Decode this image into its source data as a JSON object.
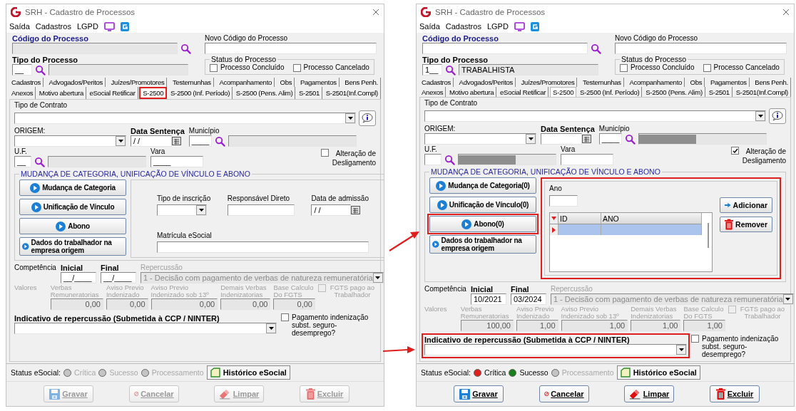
{
  "windows": [
    {
      "title": "SRH - Cadastro de Processos",
      "menu": [
        "Saída",
        "Cadastros",
        "LGPD"
      ],
      "codigo": {
        "label": "Código do Processo",
        "disabled": true
      },
      "novo_codigo": {
        "label": "Novo Código do Processo"
      },
      "tipo": {
        "label": "Tipo do Processo",
        "code": "__"
      },
      "status_processo": {
        "label": "Status do Processo",
        "options": [
          {
            "label": "Processo Concluído",
            "checked": false
          },
          {
            "label": "Processo Cancelado",
            "checked": false
          }
        ]
      },
      "tab_rows": [
        {
          "tabs": [
            {
              "label": "Cadastros",
              "selected": false,
              "highlighted": false
            },
            {
              "label": "Advogados/Peritos",
              "selected": false,
              "highlighted": false
            },
            {
              "label": "Juízes/Promotores",
              "selected": false,
              "highlighted": false
            },
            {
              "label": "Testemunhas",
              "selected": false,
              "highlighted": false
            },
            {
              "label": "Acompanhamento",
              "selected": false,
              "highlighted": false
            },
            {
              "label": "Obs",
              "selected": false,
              "highlighted": false
            },
            {
              "label": "Pagamentos",
              "selected": false,
              "highlighted": false
            },
            {
              "label": "Bens Penh.",
              "selected": false,
              "highlighted": false
            }
          ]
        },
        {
          "tabs": [
            {
              "label": "Anexos",
              "selected": false,
              "highlighted": false
            },
            {
              "label": "Motivo abertura",
              "selected": false,
              "highlighted": false
            },
            {
              "label": "eSocial Retificar",
              "selected": false,
              "highlighted": false
            },
            {
              "label": "S-2500",
              "selected": true,
              "highlighted": true
            },
            {
              "label": "S-2500 (Inf. Período)",
              "selected": false,
              "highlighted": false
            },
            {
              "label": "S-2500 (Pens. Alim)",
              "selected": false,
              "highlighted": false
            },
            {
              "label": "S-2501",
              "selected": false,
              "highlighted": false
            },
            {
              "label": "S-2501(Inf.Compl)",
              "selected": false,
              "highlighted": false
            }
          ]
        }
      ],
      "contrato": {
        "label": "Tipo de Contrato"
      },
      "origem": {
        "label": "ORIGEM:"
      },
      "data_sentenca": {
        "label": "Data Sentença",
        "value": "/ /"
      },
      "municipio": {
        "label": "Município",
        "code": "____",
        "redacted": false
      },
      "uf": {
        "label": "U.F.",
        "code": "__",
        "redacted": false
      },
      "vara": {
        "label": "Vara",
        "value": "____"
      },
      "alteracao": {
        "label": "Alteração de Desligamento",
        "checked": false
      },
      "group": {
        "title": "MUDANÇA DE CATEGORIA, UNIFICAÇÃO DE VÍNCULO E ABONO",
        "buttons": [
          {
            "label": "Mudança de Categoria",
            "highlighted": false
          },
          {
            "label": "Unificação de Vínculo",
            "highlighted": false
          },
          {
            "label": "Abono",
            "highlighted": false
          },
          {
            "label": "Dados do trabalhador na empresa origem",
            "highlighted": false
          }
        ],
        "panel": {
          "kind": "vinculo",
          "highlighted": false,
          "tipo_inscricao": "Tipo de inscrição",
          "responsavel": "Responsável Direto",
          "data_admissao": {
            "label": "Data de admissão",
            "value": "/ /"
          },
          "matricula": "Matrícula eSocial"
        }
      },
      "competencia": {
        "label": "Competência",
        "inicial": {
          "label": "Inicial",
          "value": "__/____"
        },
        "final": {
          "label": "Final",
          "value": "__/____"
        },
        "repercussao": {
          "label": "Repercussão",
          "value": "1 - Decisão com pagamento de verbas de natureza remuneratória"
        }
      },
      "valores": {
        "label": "Valores",
        "items": [
          {
            "label": "Verbas Remuneratorias",
            "value": "0,00"
          },
          {
            "label": "Aviso Previo Indenizado",
            "value": "0,00"
          },
          {
            "label": "Aviso Previo Indenizado sob 13º",
            "value": "0,00"
          },
          {
            "label": "Demais Verbas Indenizatorias",
            "value": "0,00"
          },
          {
            "label": "Base Calculo Do FGTS",
            "value": "0,00"
          }
        ],
        "fgts": {
          "label": "FGTS pago ao Trabalhador",
          "checked": false
        }
      },
      "indicativo": {
        "label": "Indicativo de repercussão (Submetida à CCP / NINTER)",
        "highlighted": false
      },
      "pagamento": {
        "label": "Pagamento indenização subst. seguro-desemprego?",
        "checked": false
      },
      "status_esocial": {
        "label": "Status eSocial:",
        "items": [
          {
            "label": "Crítica",
            "color": "#c4c4c4",
            "active": false
          },
          {
            "label": "Sucesso",
            "color": "#c4c4c4",
            "active": false
          },
          {
            "label": "Processamento",
            "color": "#c4c4c4",
            "active": false
          }
        ],
        "historico": "Histórico eSocial"
      },
      "actions": [
        {
          "label": "Gravar",
          "kind": "save",
          "disabled": true
        },
        {
          "label": "Cancelar",
          "kind": "cancel",
          "disabled": true
        },
        {
          "label": "Limpar",
          "kind": "clear",
          "disabled": true
        },
        {
          "label": "Excluir",
          "kind": "delete",
          "disabled": true
        }
      ]
    },
    {
      "title": "SRH - Cadastro de Processos",
      "menu": [
        "Saída",
        "Cadastros",
        "LGPD"
      ],
      "codigo": {
        "label": "Código do Processo",
        "disabled": false
      },
      "novo_codigo": {
        "label": "Novo Código do Processo"
      },
      "tipo": {
        "label": "Tipo do Processo",
        "code": "1__",
        "description": "TRABALHISTA"
      },
      "status_processo": {
        "label": "Status do Processo",
        "options": [
          {
            "label": "Processo Concluído",
            "checked": false
          },
          {
            "label": "Processo Cancelado",
            "checked": false
          }
        ]
      },
      "tab_rows": [
        {
          "tabs": [
            {
              "label": "Cadastros",
              "selected": false,
              "highlighted": false
            },
            {
              "label": "Advogados/Peritos",
              "selected": false,
              "highlighted": false
            },
            {
              "label": "Juízes/Promotores",
              "selected": false,
              "highlighted": false
            },
            {
              "label": "Testemunhas",
              "selected": false,
              "highlighted": false
            },
            {
              "label": "Acompanhamento",
              "selected": false,
              "highlighted": false
            },
            {
              "label": "Obs",
              "selected": false,
              "highlighted": false
            },
            {
              "label": "Pagamentos",
              "selected": false,
              "highlighted": false
            },
            {
              "label": "Bens Penh.",
              "selected": false,
              "highlighted": false
            }
          ]
        },
        {
          "tabs": [
            {
              "label": "Anexos",
              "selected": false,
              "highlighted": false
            },
            {
              "label": "Motivo abertura",
              "selected": false,
              "highlighted": false
            },
            {
              "label": "eSocial Retificar",
              "selected": false,
              "highlighted": false
            },
            {
              "label": "S-2500",
              "selected": true,
              "highlighted": false
            },
            {
              "label": "S-2500 (Inf. Período)",
              "selected": false,
              "highlighted": false
            },
            {
              "label": "S-2500 (Pens. Alim)",
              "selected": false,
              "highlighted": false
            },
            {
              "label": "S-2501",
              "selected": false,
              "highlighted": false
            },
            {
              "label": "S-2501(Inf.Compl)",
              "selected": false,
              "highlighted": false
            }
          ]
        }
      ],
      "contrato": {
        "label": "Tipo de Contrato"
      },
      "origem": {
        "label": "ORIGEM:"
      },
      "data_sentenca": {
        "label": "Data Sentença"
      },
      "municipio": {
        "label": "Município",
        "code": "____",
        "redacted": true
      },
      "uf": {
        "label": "U.F.",
        "redacted": true
      },
      "vara": {
        "label": "Vara"
      },
      "alteracao": {
        "label": "Alteração de Desligamento",
        "checked": true
      },
      "group": {
        "title": "MUDANÇA DE CATEGORIA, UNIFICAÇÃO DE VÍNCULO E ABONO",
        "buttons": [
          {
            "label": "Mudança de Categoria(0)",
            "highlighted": false
          },
          {
            "label": "Unificação de Vínculo(0)",
            "highlighted": false
          },
          {
            "label": "Abono(0)",
            "highlighted": true
          },
          {
            "label": "Dados do trabalhador na empresa origem",
            "highlighted": false
          }
        ],
        "panel": {
          "kind": "abono",
          "highlighted": true,
          "ano": "Ano",
          "columns": [
            "ID",
            "ANO"
          ],
          "rows": [
            {
              "selected": true
            }
          ],
          "add": "Adicionar",
          "remove": "Remover"
        }
      },
      "competencia": {
        "label": "Competência",
        "inicial": {
          "label": "Inicial",
          "value": "10/2021"
        },
        "final": {
          "label": "Final",
          "value": "03/2024"
        },
        "repercussao": {
          "label": "Repercussão",
          "value": "1 - Decisão com pagamento de verbas de natureza remuneratória"
        }
      },
      "valores": {
        "label": "Valores",
        "items": [
          {
            "label": "Verbas Remuneratorias",
            "value": "100,00"
          },
          {
            "label": "Aviso Previo Indenizado",
            "value": "1,00"
          },
          {
            "label": "Aviso Previo Indenizado sob 13º",
            "value": "1,00"
          },
          {
            "label": "Demais Verbas Indenizatorias",
            "value": "1,00"
          },
          {
            "label": "Base Calculo Do FGTS",
            "value": "1,00"
          }
        ],
        "fgts": {
          "label": "FGTS pago ao Trabalhador",
          "checked": false
        }
      },
      "indicativo": {
        "label": "Indicativo de repercussão (Submetida à CCP / NINTER)",
        "highlighted": true
      },
      "pagamento": {
        "label": "Pagamento indenização subst. seguro-desemprego?",
        "checked": false
      },
      "status_esocial": {
        "label": "Status eSocial:",
        "items": [
          {
            "label": "Crítica",
            "color": "#e0201c",
            "active": true
          },
          {
            "label": "Sucesso",
            "color": "#1a7f1a",
            "active": true
          },
          {
            "label": "Processamento",
            "color": "#c4c4c4",
            "active": false
          }
        ],
        "historico": "Histórico eSocial"
      },
      "actions": [
        {
          "label": "Gravar",
          "kind": "save",
          "disabled": false
        },
        {
          "label": "Cancelar",
          "kind": "cancel",
          "disabled": false
        },
        {
          "label": "Limpar",
          "kind": "clear",
          "disabled": false
        },
        {
          "label": "Excluir",
          "kind": "delete",
          "disabled": false
        }
      ]
    }
  ]
}
